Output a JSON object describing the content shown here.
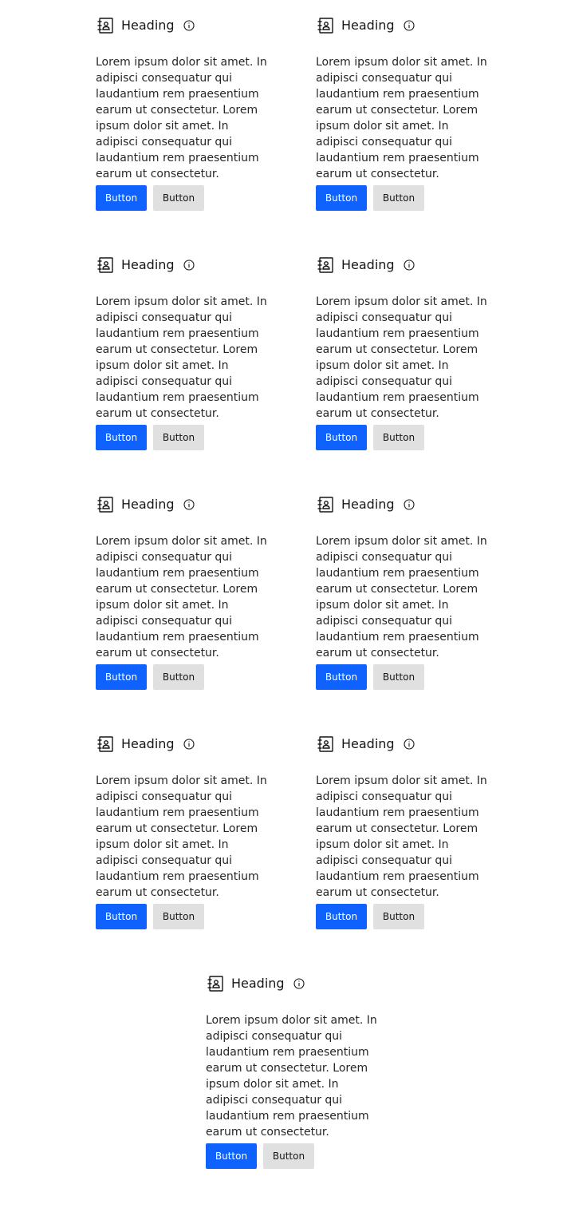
{
  "cards": [
    {
      "heading": "Heading",
      "icon": "contact-card-icon",
      "info_icon": "info-icon",
      "body": "Lorem ipsum dolor sit amet. In adipisci consequatur qui laudantium rem praesentium earum ut consectetur. Lorem ipsum dolor sit amet. In adipisci consequatur qui laudantium rem praesentium earum ut consectetur.",
      "primary_button": "Button",
      "secondary_button": "Button"
    },
    {
      "heading": "Heading",
      "icon": "contact-card-icon",
      "info_icon": "info-icon",
      "body": "Lorem ipsum dolor sit amet. In adipisci consequatur qui laudantium rem praesentium earum ut consectetur. Lorem ipsum dolor sit amet. In adipisci consequatur qui laudantium rem praesentium earum ut consectetur.",
      "primary_button": "Button",
      "secondary_button": "Button"
    },
    {
      "heading": "Heading",
      "icon": "contact-card-icon",
      "info_icon": "info-icon",
      "body": "Lorem ipsum dolor sit amet. In adipisci consequatur qui laudantium rem praesentium earum ut consectetur. Lorem ipsum dolor sit amet. In adipisci consequatur qui laudantium rem praesentium earum ut consectetur.",
      "primary_button": "Button",
      "secondary_button": "Button"
    },
    {
      "heading": "Heading",
      "icon": "contact-card-icon",
      "info_icon": "info-icon",
      "body": "Lorem ipsum dolor sit amet. In adipisci consequatur qui laudantium rem praesentium earum ut consectetur. Lorem ipsum dolor sit amet. In adipisci consequatur qui laudantium rem praesentium earum ut consectetur.",
      "primary_button": "Button",
      "secondary_button": "Button"
    },
    {
      "heading": "Heading",
      "icon": "contact-card-icon",
      "info_icon": "info-icon",
      "body": "Lorem ipsum dolor sit amet. In adipisci consequatur qui laudantium rem praesentium earum ut consectetur. Lorem ipsum dolor sit amet. In adipisci consequatur qui laudantium rem praesentium earum ut consectetur.",
      "primary_button": "Button",
      "secondary_button": "Button"
    },
    {
      "heading": "Heading",
      "icon": "contact-card-icon",
      "info_icon": "info-icon",
      "body": "Lorem ipsum dolor sit amet. In adipisci consequatur qui laudantium rem praesentium earum ut consectetur. Lorem ipsum dolor sit amet. In adipisci consequatur qui laudantium rem praesentium earum ut consectetur.",
      "primary_button": "Button",
      "secondary_button": "Button"
    },
    {
      "heading": "Heading",
      "icon": "contact-card-icon",
      "info_icon": "info-icon",
      "body": "Lorem ipsum dolor sit amet. In adipisci consequatur qui laudantium rem praesentium earum ut consectetur. Lorem ipsum dolor sit amet. In adipisci consequatur qui laudantium rem praesentium earum ut consectetur.",
      "primary_button": "Button",
      "secondary_button": "Button"
    },
    {
      "heading": "Heading",
      "icon": "contact-card-icon",
      "info_icon": "info-icon",
      "body": "Lorem ipsum dolor sit amet. In adipisci consequatur qui laudantium rem praesentium earum ut consectetur. Lorem ipsum dolor sit amet. In adipisci consequatur qui laudantium rem praesentium earum ut consectetur.",
      "primary_button": "Button",
      "secondary_button": "Button"
    },
    {
      "heading": "Heading",
      "icon": "contact-card-icon",
      "info_icon": "info-icon",
      "body": "Lorem ipsum dolor sit amet. In adipisci consequatur qui laudantium rem praesentium earum ut consectetur. Lorem ipsum dolor sit amet. In adipisci consequatur qui laudantium rem praesentium earum ut consectetur.",
      "primary_button": "Button",
      "secondary_button": "Button"
    }
  ],
  "colors": {
    "primary": "#0f62fe",
    "secondary": "#e0e0e0",
    "text": "#161616"
  }
}
